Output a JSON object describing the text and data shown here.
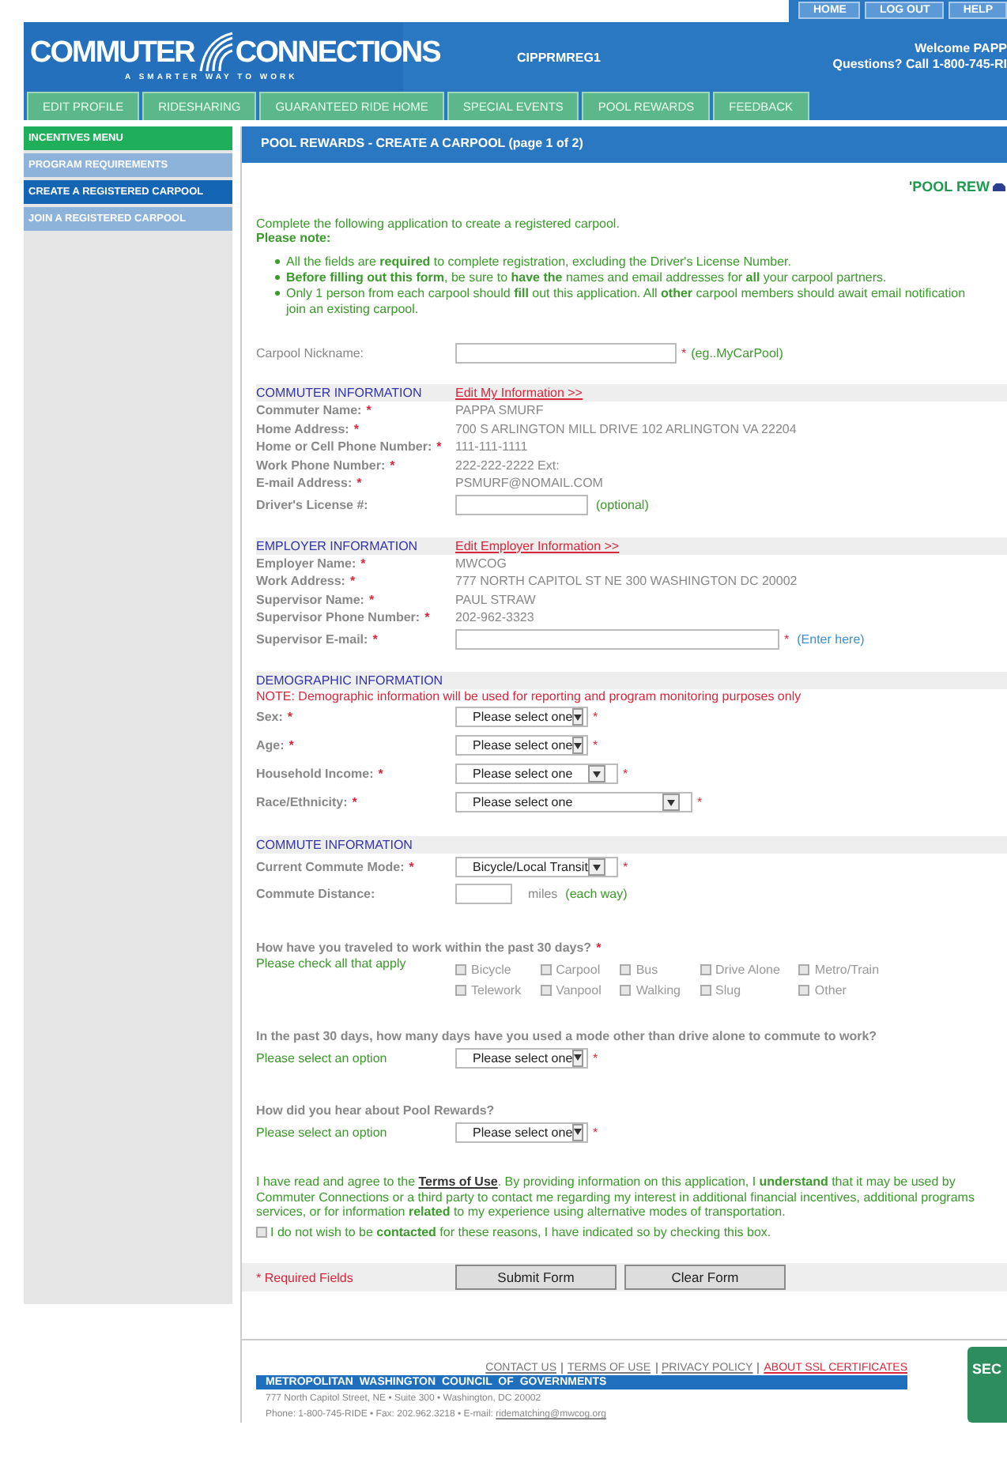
{
  "header": {
    "top_buttons": [
      "HOME",
      "LOG OUT",
      "HELP"
    ],
    "logo": {
      "left": "COMMUTER",
      "right": "CONNECTIONS",
      "tagline": "A SMARTER WAY TO WORK"
    },
    "page_code": "CIPPRMREG1",
    "welcome": "Welcome PAPP",
    "questions": "Questions? Call 1-800-745-RI"
  },
  "nav_tabs": [
    {
      "label": "EDIT PROFILE",
      "selected": false
    },
    {
      "label": "RIDESHARING",
      "selected": false
    },
    {
      "label": "GUARANTEED RIDE HOME",
      "selected": false
    },
    {
      "label": "SPECIAL EVENTS",
      "selected": false
    },
    {
      "label": "POOL REWARDS",
      "selected": false
    },
    {
      "label": "FEEDBACK",
      "selected": false
    }
  ],
  "sidebar": {
    "items": [
      {
        "kind": "header",
        "label": "INCENTIVES MENU",
        "selected": false
      },
      {
        "kind": "item",
        "label": "PROGRAM REQUIREMENTS",
        "selected": false
      },
      {
        "kind": "item",
        "label": "CREATE A REGISTERED CARPOOL",
        "selected": true
      },
      {
        "kind": "item",
        "label": "JOIN A REGISTERED CARPOOL",
        "selected": false
      }
    ]
  },
  "page_title": "POOL REWARDS - CREATE A CARPOOL (page 1 of 2)",
  "brand_logo": "'POOL REW",
  "intro": "Complete the following application to create a registered carpool.",
  "note_heading": "Please note:",
  "notes": [
    "All the fields are **required** to complete registration, excluding the Driver's License Number.",
    "**Before filling out this form**, be sure to **have the** names and email addresses for **all** your carpool partners.",
    "Only 1 person from each carpool should **fill** out this application. All **other** carpool members should await email notification",
    "join an existing carpool."
  ],
  "nickname": {
    "label": "Carpool Nickname:",
    "mark": "*",
    "hint": "(eg..MyCarPool)"
  },
  "sections": [
    {
      "title": "COMMUTER INFORMATION",
      "link": "Edit My Information >>",
      "rows": [
        {
          "kind": "text",
          "label": "Commuter Name:",
          "mark": "*",
          "value": "PAPPA SMURF"
        },
        {
          "kind": "text",
          "label": "Home Address:",
          "mark": "*",
          "value": "700 S ARLINGTON MILL DRIVE 102 ARLINGTON VA 22204"
        },
        {
          "kind": "text",
          "label": "Home or Cell Phone Number:",
          "mark": "*",
          "value": "111-111-1111"
        },
        {
          "kind": "text",
          "label": "Work Phone Number:",
          "mark": "*",
          "value": "222-222-2222 Ext:"
        },
        {
          "kind": "text",
          "label": "E-mail Address:",
          "mark": "*",
          "value": "PSMURF@NOMAIL.COM"
        },
        {
          "kind": "input",
          "label": "Driver's License #:",
          "hint": "(optional)"
        }
      ]
    },
    {
      "title": "EMPLOYER INFORMATION",
      "link": "Edit Employer Information >>",
      "rows": [
        {
          "kind": "text",
          "label": "Employer Name:",
          "mark": "*",
          "value": "MWCOG"
        },
        {
          "kind": "text",
          "label": "Work Address:",
          "mark": "*",
          "value": "777 NORTH CAPITOL ST NE 300 WASHINGTON DC 20002"
        },
        {
          "kind": "text",
          "label": "Supervisor Name:",
          "mark": "*",
          "value": "PAUL STRAW"
        },
        {
          "kind": "text",
          "label": "Supervisor Phone Number:",
          "mark": "*",
          "value": "202-962-3323"
        },
        {
          "kind": "input",
          "label": "Supervisor E-mail:",
          "mark": "*",
          "hint": "(Enter here)"
        }
      ]
    },
    {
      "title": "DEMOGRAPHIC INFORMATION",
      "note": "NOTE: Demographic information will be used for reporting and program monitoring purposes only",
      "rows": [
        {
          "kind": "select",
          "label": "Sex:",
          "mark": "*",
          "value": "Please select one"
        },
        {
          "kind": "select",
          "label": "Age:",
          "mark": "*",
          "value": "Please select one"
        },
        {
          "kind": "select",
          "label": "Household Income:",
          "mark": "*",
          "value": "Please select one"
        },
        {
          "kind": "select",
          "label": "Race/Ethnicity:",
          "mark": "*",
          "value": "Please select one"
        }
      ]
    },
    {
      "title": "COMMUTE INFORMATION",
      "rows": [
        {
          "kind": "select",
          "label": "Current Commute Mode:",
          "mark": "*",
          "value": "Bicycle/Local Transit"
        },
        {
          "kind": "input",
          "label": "Commute Distance:",
          "unit": "miles",
          "hint": "(each way)"
        }
      ]
    }
  ],
  "travel_question": {
    "question": "How have you traveled to work within the past 30 days?",
    "mark": "*",
    "instruction": "Please check all that apply",
    "options": [
      {
        "label": "Bicycle",
        "checked": false
      },
      {
        "label": "Carpool",
        "checked": false
      },
      {
        "label": "Bus",
        "checked": false
      },
      {
        "label": "Drive Alone",
        "checked": false
      },
      {
        "label": "Metro/Train",
        "checked": false
      },
      {
        "label": "Telework",
        "checked": false
      },
      {
        "label": "Vanpool",
        "checked": false
      },
      {
        "label": "Walking",
        "checked": false
      },
      {
        "label": "Slug",
        "checked": false
      },
      {
        "label": "Other",
        "checked": false
      }
    ]
  },
  "select_questions": [
    {
      "question": "In the past 30 days, how many days have you used a mode other than drive alone to commute to work?",
      "instruction": "Please select an option",
      "value": "Please select one",
      "mark": "*"
    },
    {
      "question": "How did you hear about Pool Rewards?",
      "instruction": "Please select an option",
      "value": "Please select one",
      "mark": "*"
    }
  ],
  "consent": {
    "before": "I have read and agree to the",
    "link": "Terms of Use",
    "after": ". By providing information on this application, I **understand** that it may be used by Commuter Connections or a third party to contact me regarding my interest in additional financial incentives, additional programs services, or for information **related** to my experience using alternative modes of transportation.",
    "opt_out": "I do not wish to be **contacted** for these reasons, I have indicated so by checking this box.",
    "checked": false
  },
  "required_note": "* Required Fields",
  "buttons": [
    "Submit Form",
    "Clear Form"
  ],
  "footer": {
    "links": [
      {
        "label": "CONTACT US",
        "kind": "plain"
      },
      {
        "label": "TERMS OF USE",
        "kind": "plain"
      },
      {
        "label": "PRIVACY POLICY",
        "kind": "plain"
      },
      {
        "label": "ABOUT SSL CERTIFICATES",
        "kind": "alert"
      }
    ],
    "org": "METROPOLITAN WASHINGTON COUNCIL OF GOVERNMENTS",
    "address": "777 North Capitol Street, NE • Suite 300 • Washington, DC 20002",
    "contact": "Phone: 1-800-745-RIDE • Fax: 202.962.3218 • E-mail:",
    "email": "ridematching@mwcog.org",
    "seal": "SEC"
  }
}
